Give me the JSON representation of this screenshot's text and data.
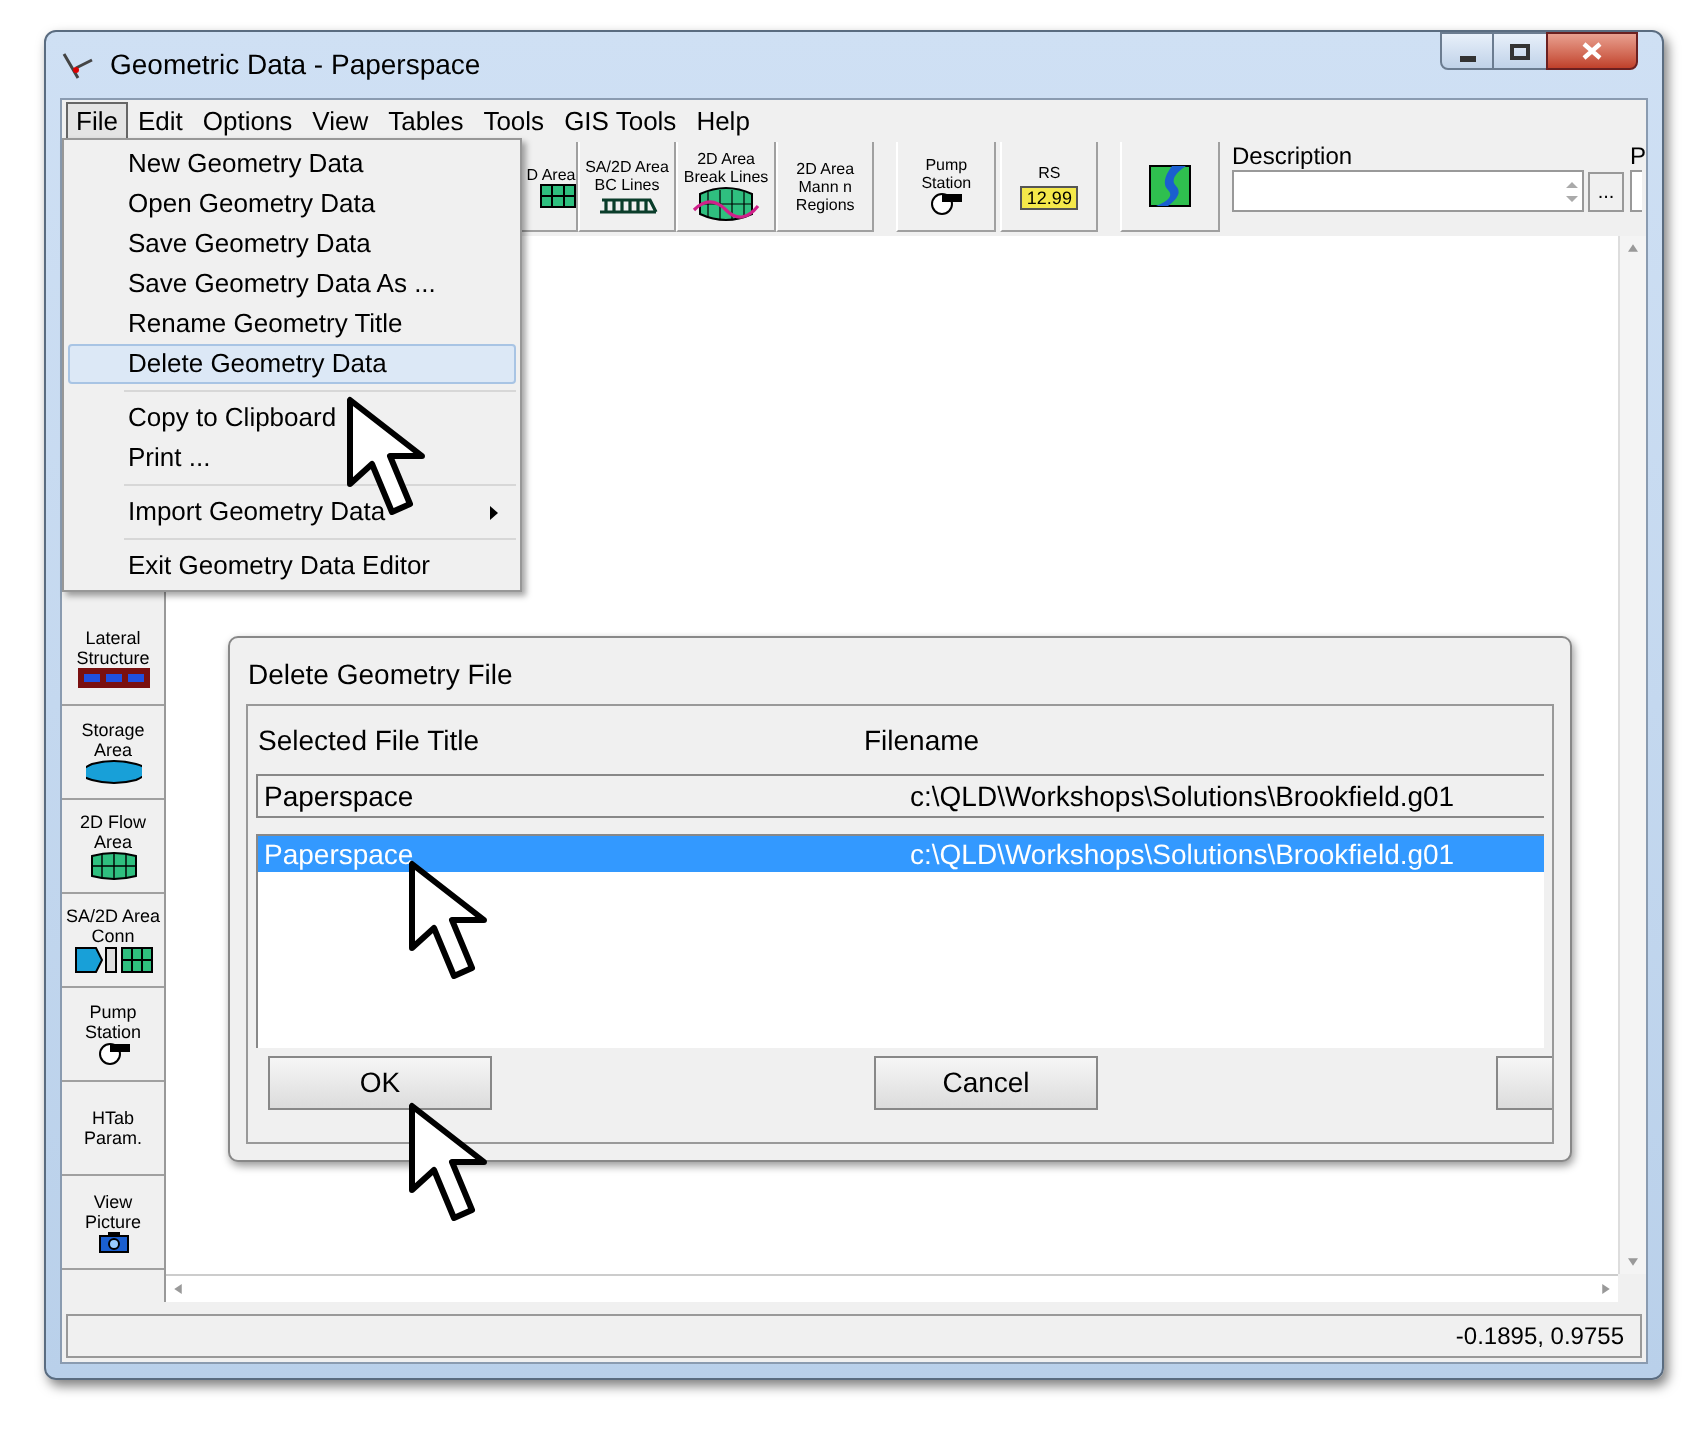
{
  "window": {
    "title": "Geometric Data - Paperspace"
  },
  "menu_bar": [
    {
      "label": "File",
      "selected": true
    },
    {
      "label": "Edit",
      "selected": false
    },
    {
      "label": "Options",
      "selected": false
    },
    {
      "label": "View",
      "selected": false
    },
    {
      "label": "Tables",
      "selected": false
    },
    {
      "label": "Tools",
      "selected": false
    },
    {
      "label": "GIS Tools",
      "selected": false
    },
    {
      "label": "Help",
      "selected": false
    }
  ],
  "file_menu": [
    {
      "kind": "item",
      "label": "New Geometry Data",
      "selected": false
    },
    {
      "kind": "item",
      "label": "Open Geometry Data",
      "selected": false
    },
    {
      "kind": "item",
      "label": "Save Geometry Data",
      "selected": false
    },
    {
      "kind": "item",
      "label": "Save Geometry Data As ...",
      "selected": false
    },
    {
      "kind": "item",
      "label": "Rename Geometry Title",
      "selected": false
    },
    {
      "kind": "item",
      "label": "Delete Geometry Data",
      "selected": true
    },
    {
      "kind": "separator"
    },
    {
      "kind": "item",
      "label": "Copy to Clipboard",
      "selected": false
    },
    {
      "kind": "item",
      "label": "Print ...",
      "selected": false
    },
    {
      "kind": "separator"
    },
    {
      "kind": "submenu",
      "label": "Import Geometry Data",
      "selected": false
    },
    {
      "kind": "separator"
    },
    {
      "kind": "item",
      "label": "Exit Geometry Data Editor",
      "selected": false
    }
  ],
  "toolbar": [
    {
      "lines": [
        "D Area"
      ]
    },
    {
      "lines": [
        "SA/2D Area",
        "BC Lines"
      ]
    },
    {
      "lines": [
        "2D Area",
        "Break Lines"
      ]
    },
    {
      "lines": [
        "2D Area",
        "Mann n",
        "Regions"
      ]
    },
    {
      "lines": [
        "Pump",
        "Station"
      ]
    },
    {
      "lines": [
        "RS"
      ],
      "tag": "12.99"
    }
  ],
  "description": {
    "label": "Description",
    "more_button": "...",
    "cut_label": "P"
  },
  "side_toolbar": [
    {
      "lines": [
        "Lateral",
        "Structure"
      ]
    },
    {
      "lines": [
        "Storage",
        "Area"
      ]
    },
    {
      "lines": [
        "2D Flow",
        "Area"
      ]
    },
    {
      "lines": [
        "SA/2D Area",
        "Conn"
      ]
    },
    {
      "lines": [
        "Pump",
        "Station"
      ]
    },
    {
      "lines": [
        "HTab",
        "Param."
      ]
    },
    {
      "lines": [
        "View",
        "Picture"
      ]
    }
  ],
  "dialog": {
    "title": "Delete Geometry File",
    "columns": [
      "Selected File Title",
      "Filename"
    ],
    "current": {
      "title": "Paperspace",
      "filename": "c:\\QLD\\Workshops\\Solutions\\Brookfield.g01"
    },
    "rows": [
      {
        "title": "Paperspace",
        "filename": "c:\\QLD\\Workshops\\Solutions\\Brookfield.g01",
        "selected": true
      }
    ],
    "buttons": [
      "OK",
      "Cancel"
    ]
  },
  "status_bar": {
    "coordinates": "-0.1895, 0.9755"
  }
}
